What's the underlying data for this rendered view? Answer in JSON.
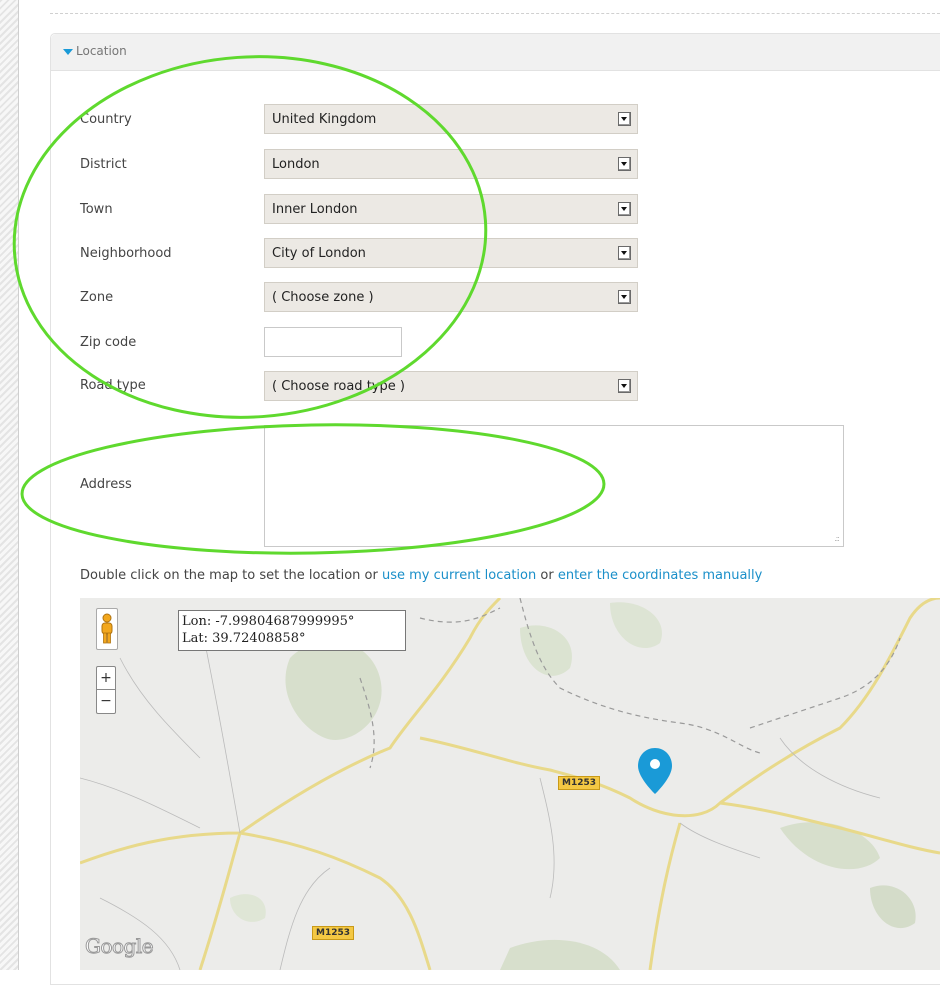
{
  "panel": {
    "title": "Location"
  },
  "fields": [
    {
      "label": "Country",
      "value": "United Kingdom",
      "type": "select"
    },
    {
      "label": "District",
      "value": "London",
      "type": "select"
    },
    {
      "label": "Town",
      "value": "Inner London",
      "type": "select"
    },
    {
      "label": "Neighborhood",
      "value": "City of London",
      "type": "select"
    },
    {
      "label": "Zone",
      "value": "( Choose zone )",
      "type": "select"
    },
    {
      "label": "Zip code",
      "value": "",
      "type": "text"
    },
    {
      "label": "Road type",
      "value": "( Choose road type )",
      "type": "select"
    }
  ],
  "address": {
    "label": "Address",
    "value": ""
  },
  "hint": {
    "prefix": "Double click on the map to set the location or",
    "link1": "use my current location",
    "middle": "or",
    "link2": "enter the coordinates manually"
  },
  "map": {
    "coords": {
      "lon": "Lon: -7.99804687999995°",
      "lat": "Lat: 39.72408858°"
    },
    "zoom_in": "+",
    "zoom_out": "−",
    "road_labels": [
      "M1253",
      "M1253"
    ],
    "logo": "Google",
    "marker_color": "#1a9ad7"
  },
  "colors": {
    "accent": "#1a9ad7",
    "annotation": "#5fd92e"
  }
}
